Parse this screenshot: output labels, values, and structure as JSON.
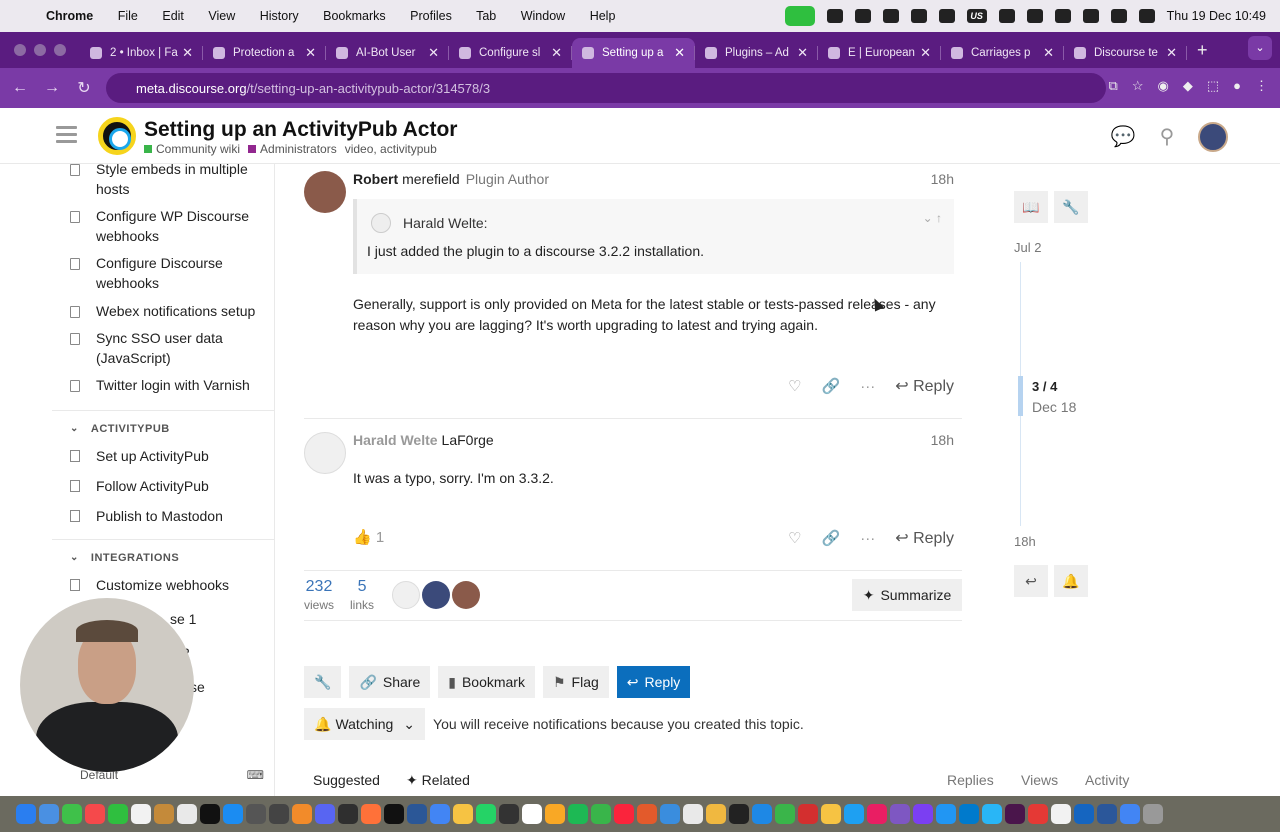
{
  "macos": {
    "app_name": "Chrome",
    "menus": [
      "File",
      "Edit",
      "View",
      "History",
      "Bookmarks",
      "Profiles",
      "Tab",
      "Window",
      "Help"
    ],
    "input_source": "US",
    "clock": "Thu 19 Dec  10:49"
  },
  "browser": {
    "tabs": [
      {
        "title": "2 • Inbox | Fa",
        "active": false
      },
      {
        "title": "Protection a",
        "active": false
      },
      {
        "title": "AI-Bot User",
        "active": false
      },
      {
        "title": "Configure sl",
        "active": false
      },
      {
        "title": "Setting up a",
        "active": true
      },
      {
        "title": "Plugins – Ad",
        "active": false
      },
      {
        "title": "E | European",
        "active": false
      },
      {
        "title": "Carriages p",
        "active": false
      },
      {
        "title": "Discourse te",
        "active": false
      }
    ],
    "url_host": "meta.discourse.org",
    "url_path": "/t/setting-up-an-activitypub-actor/314578/3"
  },
  "header": {
    "topic_title": "Setting up an ActivityPub Actor",
    "category": "Community wiki",
    "category_color": "#3ab54a",
    "subcategory": "Administrators",
    "subcategory_color": "#92278f",
    "tags": "video, activitypub"
  },
  "sidebar": {
    "items_top": [
      {
        "label": "Style embeds in multiple hosts"
      },
      {
        "label": "Configure WP Discourse webhooks"
      },
      {
        "label": "Configure Discourse webhooks"
      },
      {
        "label": "Webex notifications setup"
      },
      {
        "label": "Sync SSO user data (JavaScript)"
      },
      {
        "label": "Twitter login with Varnish"
      }
    ],
    "section_activitypub": "ACTIVITYPUB",
    "activitypub_items": [
      {
        "label": "Set up ActivityPub"
      },
      {
        "label": "Follow ActivityPub"
      },
      {
        "label": "Publish to Mastodon"
      }
    ],
    "section_integrations": "INTEGRATIONS",
    "integrations_items": [
      {
        "label": "Customize webhooks"
      },
      {
        "label": "se 1"
      },
      {
        "label": "2"
      },
      {
        "label": "se"
      }
    ],
    "footer_label": "Default"
  },
  "posts": [
    {
      "name": "Robert",
      "username": "merefield",
      "flair": "Plugin Author",
      "date": "18h",
      "quote_author": "Harald Welte:",
      "quote_text": "I just added the plugin to a discourse 3.2.2 installation.",
      "body": "Generally, support is only provided on Meta for the latest stable or tests-passed releases - any reason why you are lagging? It's worth upgrading to latest and trying again.",
      "reply_label": "Reply"
    },
    {
      "name": "Harald Welte",
      "username": "LaF0rge",
      "date": "18h",
      "body": "It was a typo, sorry. I'm on 3.3.2.",
      "likes": "1",
      "reply_label": "Reply"
    }
  ],
  "topic_stats": {
    "views": "232",
    "views_label": "views",
    "links": "5",
    "links_label": "links",
    "summarize_label": "Summarize"
  },
  "footer_buttons": {
    "share": "Share",
    "bookmark": "Bookmark",
    "flag": "Flag",
    "reply": "Reply"
  },
  "notifications": {
    "level": "Watching",
    "text": "You will receive notifications because you created this topic."
  },
  "suggested_tabs": {
    "suggested": "Suggested",
    "related": "Related",
    "replies": "Replies",
    "views": "Views",
    "activity": "Activity"
  },
  "timeline": {
    "start_date": "Jul 2",
    "position": "3 / 4",
    "position_date": "Dec 18",
    "end_date": "18h"
  }
}
